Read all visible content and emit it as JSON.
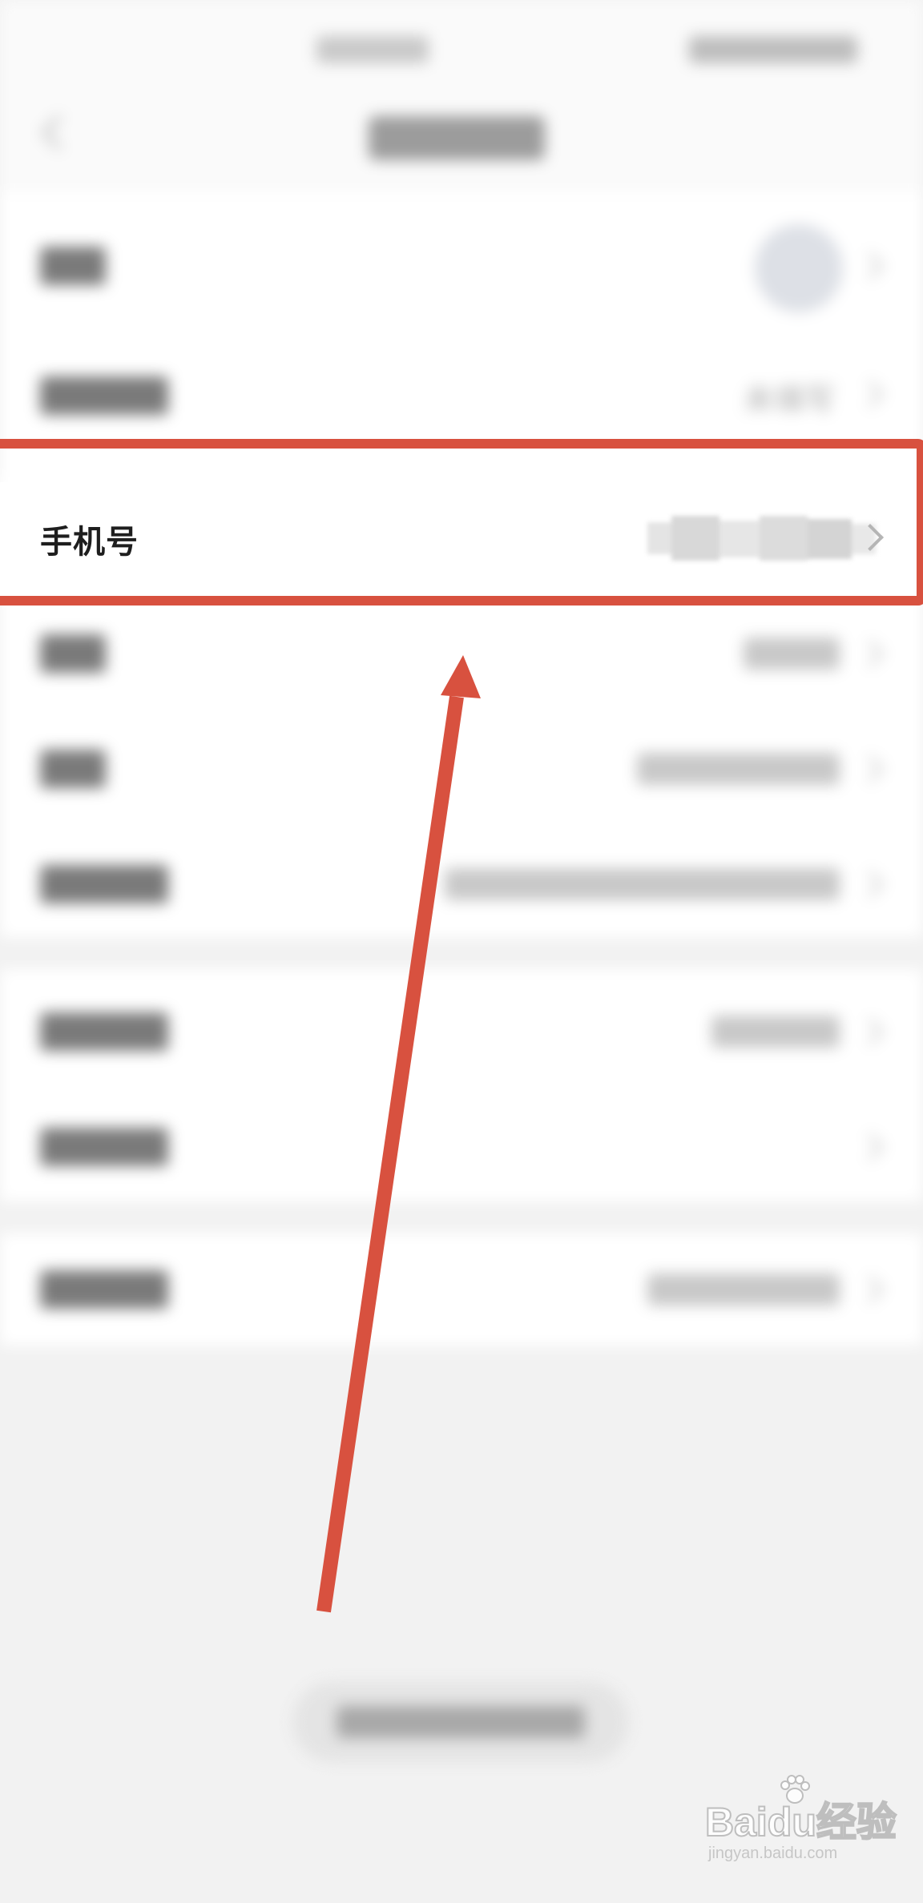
{
  "phone_row": {
    "label": "手机号"
  },
  "blurred_rows": {
    "region_value": "未填写"
  },
  "watermark": {
    "brand": "Baidu经验",
    "url": "jingyan.baidu.com"
  },
  "colors": {
    "highlight": "#d8513f",
    "background": "#f2f2f2",
    "row_background": "#ffffff"
  },
  "icons": {
    "back": "chevron-left-icon",
    "row_arrow": "chevron-right-icon",
    "annotation_arrow": "arrow-up-icon"
  }
}
